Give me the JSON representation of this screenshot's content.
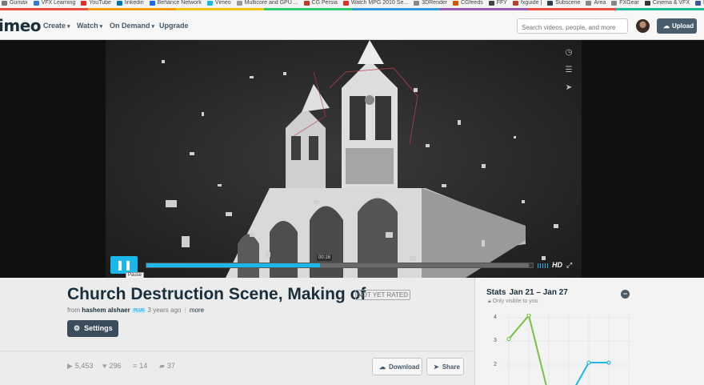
{
  "bookmarks": [
    {
      "label": "Gumax",
      "color": "#7a7a7a"
    },
    {
      "label": "VFX Learning",
      "color": "#2e7bd6"
    },
    {
      "label": "YouTube",
      "color": "#e52d27"
    },
    {
      "label": "linkedin",
      "color": "#0077b5"
    },
    {
      "label": "Behance Network",
      "color": "#1769ff"
    },
    {
      "label": "Vimeo",
      "color": "#19b7ea"
    },
    {
      "label": "Multicore and GPU ...",
      "color": "#999999"
    },
    {
      "label": "CG Persia",
      "color": "#c0392b"
    },
    {
      "label": "Watch MPG 2010 Se...",
      "color": "#e52d27"
    },
    {
      "label": "3DRender",
      "color": "#888888"
    },
    {
      "label": "CGfeeds",
      "color": "#d35400"
    },
    {
      "label": "FFY",
      "color": "#444444"
    },
    {
      "label": "fxguide |",
      "color": "#c0392b"
    },
    {
      "label": "Subscene",
      "color": "#2c3e50"
    },
    {
      "label": "Area",
      "color": "#888888"
    },
    {
      "label": "FXGear",
      "color": "#888888"
    },
    {
      "label": "Cinema & VFX",
      "color": "#333333"
    },
    {
      "label": "Facebook",
      "color": "#3b5998"
    }
  ],
  "stripe_colors": [
    "#e74c3c",
    "#f39c12",
    "#f1c40f",
    "#2ecc71",
    "#3498db",
    "#9b59b6",
    "#e74c3c",
    "#1abc9c"
  ],
  "nav": {
    "logo": "imeo",
    "items": [
      "Create",
      "Watch",
      "On Demand",
      "Upgrade"
    ],
    "search_placeholder": "Search videos, people, and more",
    "upload_label": "Upload"
  },
  "player": {
    "timecode": "00:16",
    "progress_played": 0.45,
    "progress_loaded": 0.99,
    "tooltip": "Pause",
    "hd_label": "HD"
  },
  "video_info": {
    "title": "Church Destruction Scene, Making of",
    "rating": "NOT YET RATED",
    "from": "from",
    "author": "hashem alshaer",
    "badge": "PLUS",
    "age": "3 years ago",
    "more": "more",
    "settings_label": "Settings",
    "plays": "5,453",
    "likes": "296",
    "collections": "14",
    "comments": "37",
    "download_label": "Download",
    "share_label": "Share"
  },
  "stats_panel": {
    "title": "Stats",
    "range": "Jan 21 – Jan 27",
    "visibility": "Only visible to you"
  },
  "chart_data": {
    "type": "line",
    "yticks": [
      "4",
      "3",
      "2"
    ],
    "ylim": [
      1,
      4
    ],
    "grid": true,
    "series": [
      {
        "color": "#7ac143",
        "values": [
          3.1,
          4.1,
          0.7,
          null,
          null,
          null
        ]
      },
      {
        "color": "#19b7ea",
        "values": [
          null,
          null,
          null,
          0.6,
          2.1,
          2.1
        ]
      }
    ]
  }
}
